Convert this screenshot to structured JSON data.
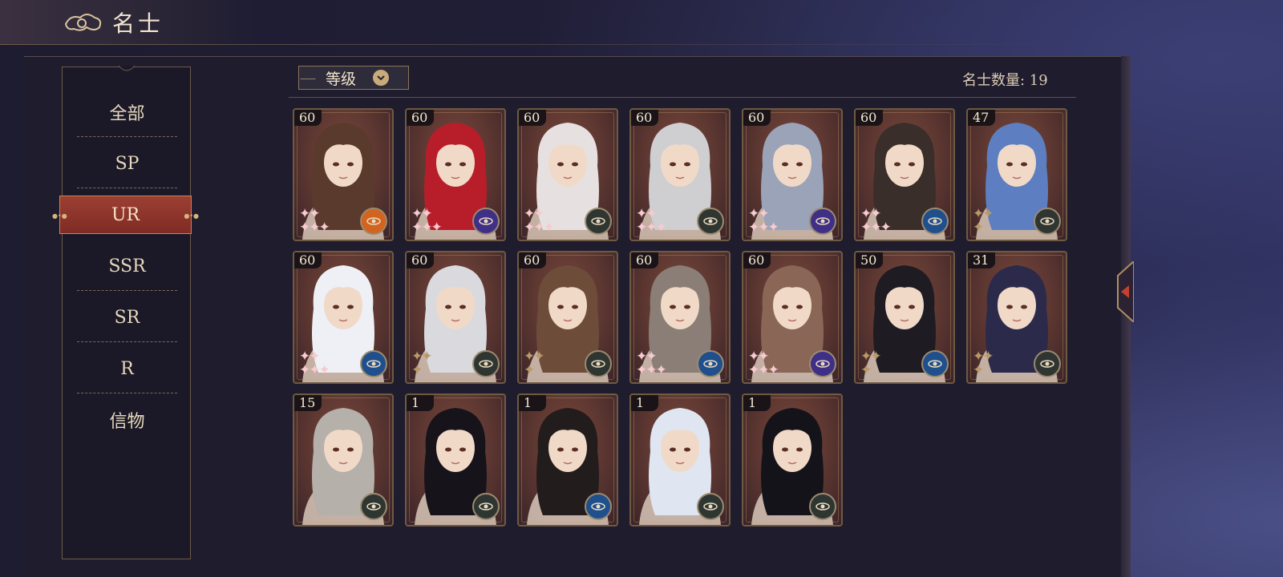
{
  "header": {
    "title": "名士"
  },
  "sidebar": {
    "items": [
      {
        "label": "全部"
      },
      {
        "label": "SP"
      },
      {
        "label": "UR"
      },
      {
        "label": "SSR"
      },
      {
        "label": "SR"
      },
      {
        "label": "R"
      },
      {
        "label": "信物"
      }
    ],
    "active": "UR"
  },
  "sort": {
    "label": "等级"
  },
  "count": {
    "label": "名士数量: 19"
  },
  "colors": {
    "accent_red": "#8c3329",
    "gold": "#c9aa7a",
    "star_pink": "#f6cbd0",
    "star_dark": "#b89968"
  },
  "cards": [
    {
      "level": "60",
      "hair": "#5a3a2c",
      "stars": "pink",
      "emblem": "orange"
    },
    {
      "level": "60",
      "hair": "#b81e2a",
      "stars": "pink",
      "emblem": "purple"
    },
    {
      "level": "60",
      "hair": "#e6e1e0",
      "stars": "pink",
      "emblem": "dark"
    },
    {
      "level": "60",
      "hair": "#cfcfd2",
      "stars": "pink",
      "emblem": "dark"
    },
    {
      "level": "60",
      "hair": "#9aa3b8",
      "stars": "pink",
      "emblem": "purple"
    },
    {
      "level": "60",
      "hair": "#3a2e2a",
      "stars": "pink",
      "emblem": "blue"
    },
    {
      "level": "47",
      "hair": "#5d7ec0",
      "stars": "dark",
      "emblem": "dark"
    },
    {
      "level": "60",
      "hair": "#eef0f6",
      "stars": "pink",
      "emblem": "blue"
    },
    {
      "level": "60",
      "hair": "#d9d9de",
      "stars": "dark",
      "emblem": "dark"
    },
    {
      "level": "60",
      "hair": "#6e4c3a",
      "stars": "dark",
      "emblem": "dark"
    },
    {
      "level": "60",
      "hair": "#8a7e76",
      "stars": "pink",
      "emblem": "blue"
    },
    {
      "level": "60",
      "hair": "#8a6656",
      "stars": "pink",
      "emblem": "purple"
    },
    {
      "level": "50",
      "hair": "#1e1c22",
      "stars": "dark",
      "emblem": "blue"
    },
    {
      "level": "31",
      "hair": "#2c2a4a",
      "stars": "dark",
      "emblem": "dark"
    },
    {
      "level": "15",
      "hair": "#b5b0aa",
      "stars": "none",
      "emblem": "dark"
    },
    {
      "level": "1",
      "hair": "#16141a",
      "stars": "none",
      "emblem": "dark"
    },
    {
      "level": "1",
      "hair": "#221c1c",
      "stars": "none",
      "emblem": "blue"
    },
    {
      "level": "1",
      "hair": "#dfe6f2",
      "stars": "none",
      "emblem": "dark"
    },
    {
      "level": "1",
      "hair": "#15131a",
      "stars": "none",
      "emblem": "dark"
    }
  ]
}
